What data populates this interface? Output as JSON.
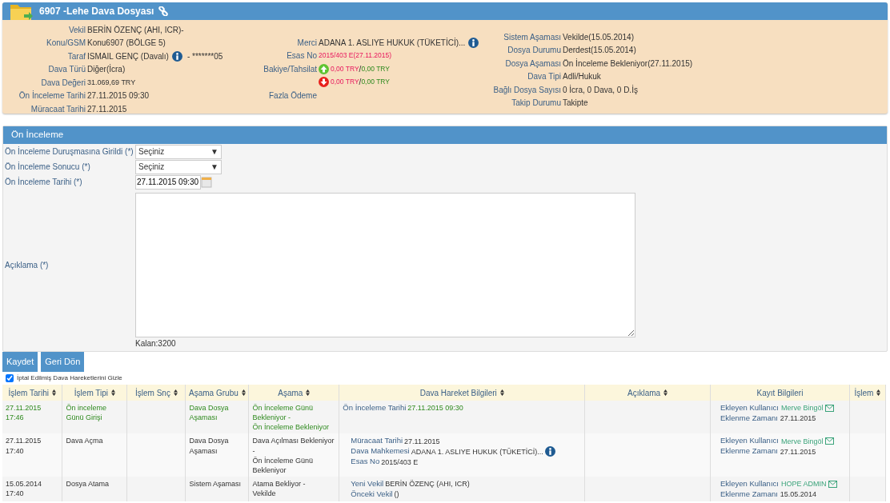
{
  "case_header": {
    "title": "6907 -Lehe Dava Dosyası",
    "columns": [
      {
        "fields": [
          {
            "label": "Vekil",
            "parts": [
              {
                "kind": "text",
                "text": "BERİN ÖZENÇ (AHI, ICR)-"
              }
            ]
          },
          {
            "label": "Konu/GSM",
            "parts": [
              {
                "kind": "text",
                "text": "Konu6907 (BÖLGE 5)"
              }
            ]
          },
          {
            "label": "Taraf",
            "parts": [
              {
                "kind": "text",
                "text": "ISMAIL GENÇ (Davalı)"
              },
              {
                "kind": "info"
              },
              {
                "kind": "text",
                "text": "- *******05"
              }
            ]
          },
          {
            "label": "Dava Türü",
            "parts": [
              {
                "kind": "text",
                "text": "Diğer(İcra)"
              }
            ]
          },
          {
            "label": "Dava Değeri",
            "parts": [
              {
                "kind": "small",
                "text": "31.069,69 TRY"
              }
            ]
          },
          {
            "label": "Ön İnceleme Tarihi",
            "parts": [
              {
                "kind": "text",
                "text": "27.11.2015 09:30"
              }
            ]
          },
          {
            "label": "Müracaat Tarihi",
            "parts": [
              {
                "kind": "text",
                "text": "27.11.2015"
              }
            ]
          }
        ]
      },
      {
        "fields": [
          {
            "label": "Merci",
            "parts": [
              {
                "kind": "text",
                "text": "ADANA 1. ASLIYE HUKUK (TÜKETİCİ)..."
              },
              {
                "kind": "info"
              }
            ]
          },
          {
            "label": "Esas No",
            "parts": [
              {
                "kind": "red",
                "text": "2015/403 E(27.11.2015)"
              }
            ]
          },
          {
            "label": "Bakiye/Tahsilat",
            "parts": [
              {
                "kind": "up"
              },
              {
                "kind": "red",
                "text": "0,00 TRY"
              },
              {
                "kind": "text",
                "text": "/"
              },
              {
                "kind": "green",
                "text": "0,00 TRY"
              }
            ]
          },
          {
            "parts": [
              {
                "kind": "down"
              },
              {
                "kind": "red",
                "text": "0,00 TRY"
              },
              {
                "kind": "text",
                "text": "/"
              },
              {
                "kind": "green",
                "text": "0,00 TRY"
              }
            ]
          },
          {
            "label": "Fazla Ödeme"
          }
        ]
      },
      {
        "fields": [
          {
            "label": "Sistem Aşaması",
            "parts": [
              {
                "kind": "text",
                "text": "Vekilde(15.05.2014)"
              }
            ]
          },
          {
            "label": "Dosya Durumu",
            "parts": [
              {
                "kind": "text",
                "text": "Derdest(15.05.2014)"
              }
            ]
          },
          {
            "label": "Dosya Aşaması",
            "parts": [
              {
                "kind": "text",
                "text": "Ön İnceleme Bekleniyor(27.11.2015)"
              }
            ]
          },
          {
            "label": "Dava Tipi",
            "parts": [
              {
                "kind": "text",
                "text": "Adli/Hukuk"
              }
            ]
          },
          {
            "label": "Bağlı Dosya Sayısı",
            "parts": [
              {
                "kind": "text",
                "text": "0 İcra, 0 Dava, 0 D.İş"
              }
            ]
          },
          {
            "label": "Takip Durumu",
            "parts": [
              {
                "kind": "text",
                "text": "Takipte"
              }
            ]
          }
        ]
      }
    ]
  },
  "form": {
    "title": "Ön İnceleme",
    "fields": [
      {
        "kind": "select",
        "label": "Ön İnceleme Duruşmasına Girildi (*)",
        "value": "Seçiniz",
        "arrow": "▼"
      },
      {
        "kind": "select",
        "label": "Ön İnceleme Sonucu (*)",
        "value": "Seçiniz",
        "arrow": "▼"
      },
      {
        "kind": "date",
        "label": "Ön İnceleme Tarihi (*)",
        "value": "27.11.2015 09:30"
      },
      {
        "kind": "textarea",
        "label": "Açıklama (*)",
        "counter": "Kalan:3200"
      }
    ]
  },
  "buttons": [
    "Kaydet",
    "Geri Dön"
  ],
  "hide_cancelled": {
    "label": "İptal Edilmiş Dava Hareketlerini Gizle",
    "checked": true
  },
  "table": {
    "columns": [
      {
        "label": "İşlem Tarihi",
        "sortable": true
      },
      {
        "label": "İşlem Tipi",
        "sortable": true
      },
      {
        "label": "İşlem Snç",
        "sortable": true
      },
      {
        "label": "Aşama Grubu",
        "sortable": true
      },
      {
        "label": "Aşama",
        "sortable": true
      },
      {
        "label": "Dava Hareket Bilgileri",
        "sortable": true
      },
      {
        "label": "Açıklama",
        "sortable": true
      },
      {
        "label": "Kayıt Bilgileri",
        "sortable": false
      },
      {
        "label": "İşlem",
        "sortable": true
      }
    ],
    "rows": [
      {
        "highlight": true,
        "date": "27.11.2015 17:46",
        "type": "Ön inceleme Günü Girişi",
        "stage_group": "Dava Dosya Aşaması",
        "stage": [
          "Ön İnceleme Günü Bekleniyor -",
          "Ön İnceleme Bekleniyor"
        ],
        "details": [
          {
            "label": "Ön İnceleme Tarihi",
            "value": "27.11.2015 09:30"
          }
        ],
        "added_by": "Merve Bingöl",
        "added_at": "27.11.2015",
        "user_label": "Ekleyen Kullanıcı",
        "time_label": "Eklenme Zamanı"
      },
      {
        "highlight": false,
        "date": "27.11.2015 17:40",
        "type": "Dava Açma",
        "stage_group": "Dava Dosya Aşaması",
        "stage": [
          "Dava Açılması Bekleniyor -",
          "Ön İnceleme Günü Bekleniyor"
        ],
        "details": [
          {
            "label": "Müracaat Tarihi",
            "value": "27.11.2015"
          },
          {
            "label": "Dava Mahkemesi",
            "value": "ADANA 1. ASLIYE HUKUK (TÜKETİCİ)...",
            "info": true
          },
          {
            "label": "Esas No",
            "value": "2015/403 E"
          }
        ],
        "added_by": "Merve Bingöl",
        "added_at": "27.11.2015",
        "user_label": "Ekleyen Kullanıcı",
        "time_label": "Eklenme Zamanı"
      },
      {
        "highlight": false,
        "date": "15.05.2014 17:40",
        "type": "Dosya Atama",
        "stage_group": "Sistem Aşaması",
        "stage": [
          "Atama Bekliyor -",
          "Vekilde"
        ],
        "details": [
          {
            "label": "Yeni Vekil",
            "value": "BERİN ÖZENÇ (AHI, ICR)"
          },
          {
            "label": "Önceki Vekil",
            "value": "()"
          }
        ],
        "added_by": "HOPE ADMIN",
        "added_at": "15.05.2014",
        "user_label": "Ekleyen Kullanıcı",
        "time_label": "Eklenme Zamanı"
      }
    ]
  }
}
